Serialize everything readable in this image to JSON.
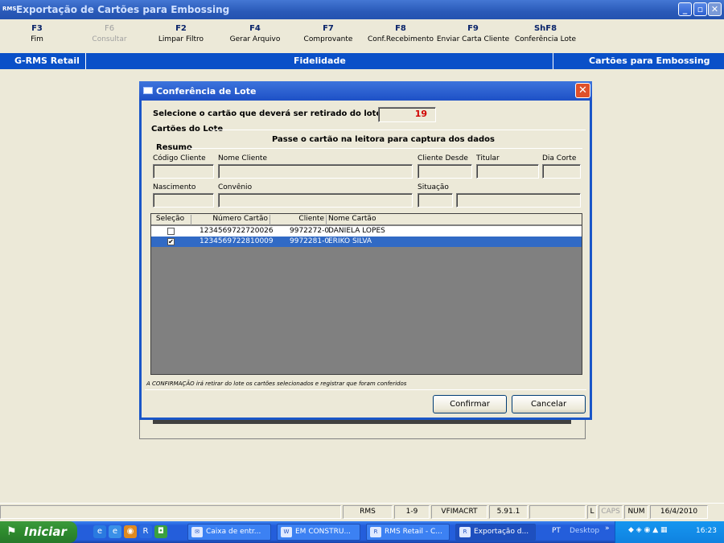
{
  "window": {
    "title": "Exportação de Cartões para Embossing",
    "app_icon_text": "RMS"
  },
  "fkeys": [
    {
      "key": "F3",
      "label": "Fim",
      "enabled": true
    },
    {
      "key": "F6",
      "label": "Consultar",
      "enabled": false
    },
    {
      "key": "F2",
      "label": "Limpar Filtro",
      "enabled": true
    },
    {
      "key": "F4",
      "label": "Gerar Arquivo",
      "enabled": true
    },
    {
      "key": "F7",
      "label": "Comprovante",
      "enabled": true
    },
    {
      "key": "F8",
      "label": "Conf.Recebimento",
      "enabled": true
    },
    {
      "key": "F9",
      "label": "Enviar Carta Cliente",
      "enabled": true
    },
    {
      "key": "ShF8",
      "label": "Conferência Lote",
      "enabled": true
    }
  ],
  "navbar": {
    "left": "G-RMS Retail",
    "center": "Fidelidade",
    "right": "Cartões para Embossing"
  },
  "dialog": {
    "title": "Conferência de Lote",
    "prompt": "Selecione o cartão que deverá ser retirado do lote:",
    "count": "19",
    "group_label": "Cartões do Lote",
    "instruction": "Passe o cartão na leitora para captura dos dados",
    "summary_label": "Resumo",
    "fields": {
      "codigo_cliente": "Código Cliente",
      "nome_cliente": "Nome Cliente",
      "cliente_desde": "Cliente Desde",
      "titular": "Titular",
      "dia_corte": "Dia Corte",
      "nascimento": "Nascimento",
      "convenio": "Convênio",
      "situacao": "Situação"
    },
    "grid": {
      "headers": {
        "selecao": "Seleção",
        "numero": "Número Cartão",
        "cliente": "Cliente",
        "nome": "Nome Cartão"
      },
      "rows": [
        {
          "checked": false,
          "numero": "1234569722720026",
          "cliente": "9972272-0",
          "nome": "DANIELA LOPES",
          "selected": false
        },
        {
          "checked": true,
          "numero": "1234569722810009",
          "cliente": "9972281-0",
          "nome": "ERIKO SILVA",
          "selected": true
        }
      ]
    },
    "footnote": "A CONFIRMAÇÃO irá retirar do lote os cartões selecionados e registrar que foram conferidos",
    "confirm_label": "Confirmar",
    "cancel_label": "Cancelar"
  },
  "statusbar": {
    "system": "RMS",
    "range": "1-9",
    "program": "VFIMACRT",
    "version": "5.91.1",
    "l": "L",
    "caps": "CAPS",
    "num": "NUM",
    "date": "16/4/2010"
  },
  "taskbar": {
    "start_label": "Iniciar",
    "buttons": [
      "Caixa de entr...",
      "EM CONSTRU...",
      "RMS Retail - C...",
      "Exportação d..."
    ],
    "lang": "PT",
    "desktop": "Desktop",
    "time": "16:23"
  },
  "colors": {
    "accent": "#0a50c8",
    "count_red": "#d00000",
    "selected_row": "#316ac5"
  }
}
